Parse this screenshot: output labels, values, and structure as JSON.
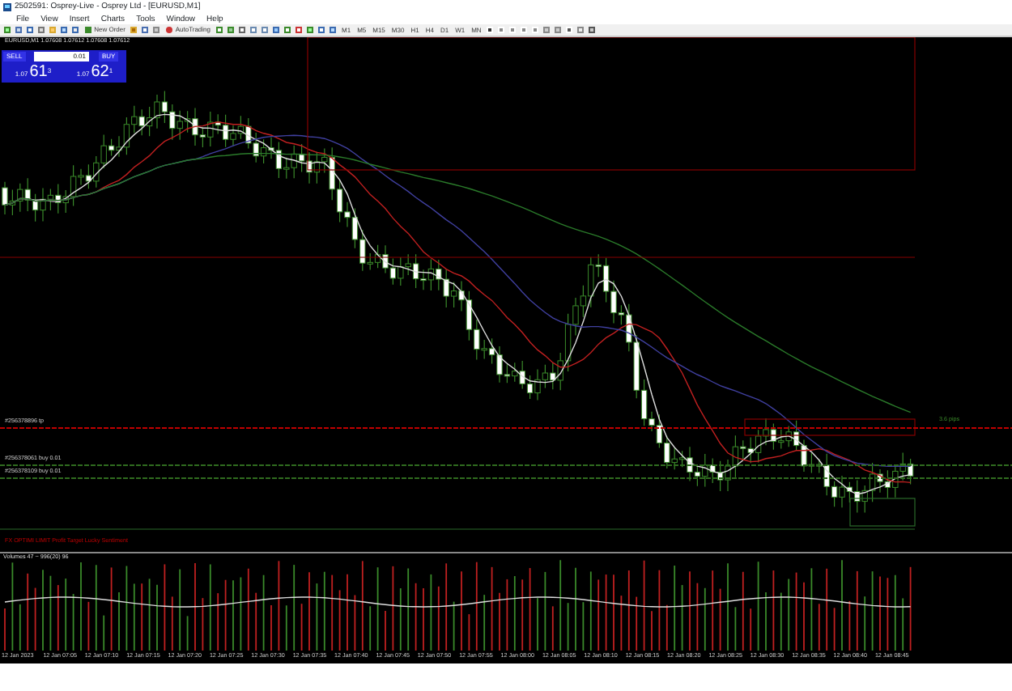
{
  "window": {
    "title": "2502591: Osprey-Live - Osprey Ltd - [EURUSD,M1]"
  },
  "menu": [
    "File",
    "View",
    "Insert",
    "Charts",
    "Tools",
    "Window",
    "Help"
  ],
  "toolbar": {
    "new_order": "New Order",
    "autotrading": "AutoTrading",
    "timeframes": [
      "M1",
      "M5",
      "M15",
      "M30",
      "H1",
      "H4",
      "D1",
      "W1",
      "MN"
    ]
  },
  "chart": {
    "header": "EURUSD,M1  1.07608 1.07612 1.07608 1.07612",
    "one_click": {
      "sell": "SELL",
      "lots": "0.01",
      "buy": "BUY",
      "sell_price": {
        "big": "1.07",
        "main": "61",
        "small": "3"
      },
      "buy_price": {
        "big": "1.07",
        "main": "62",
        "small": "1"
      }
    },
    "order_lines": [
      {
        "label": "#256378896 tp",
        "color": "#c00000"
      },
      {
        "label": "#256378061 buy 0.01",
        "color": "#2f6b1f"
      },
      {
        "label": "#256378109 buy 0.01",
        "color": "#2f6b1f"
      }
    ],
    "pips_label": "3.6 pips",
    "indicator_caption": "FX OPTIMI LIMIT  Profit Target  Lucky Sentiment"
  },
  "volume": {
    "label": "Volumes 47 ~ 996(20) 96"
  },
  "time_axis": [
    "12 Jan 2023",
    "12 Jan 07:05",
    "12 Jan 07:10",
    "12 Jan 07:15",
    "12 Jan 07:20",
    "12 Jan 07:25",
    "12 Jan 07:30",
    "12 Jan 07:35",
    "12 Jan 07:40",
    "12 Jan 07:45",
    "12 Jan 07:50",
    "12 Jan 07:55",
    "12 Jan 08:00",
    "12 Jan 08:05",
    "12 Jan 08:10",
    "12 Jan 08:15",
    "12 Jan 08:20",
    "12 Jan 08:25",
    "12 Jan 08:30",
    "12 Jan 08:35",
    "12 Jan 08:40",
    "12 Jan 08:45"
  ]
}
